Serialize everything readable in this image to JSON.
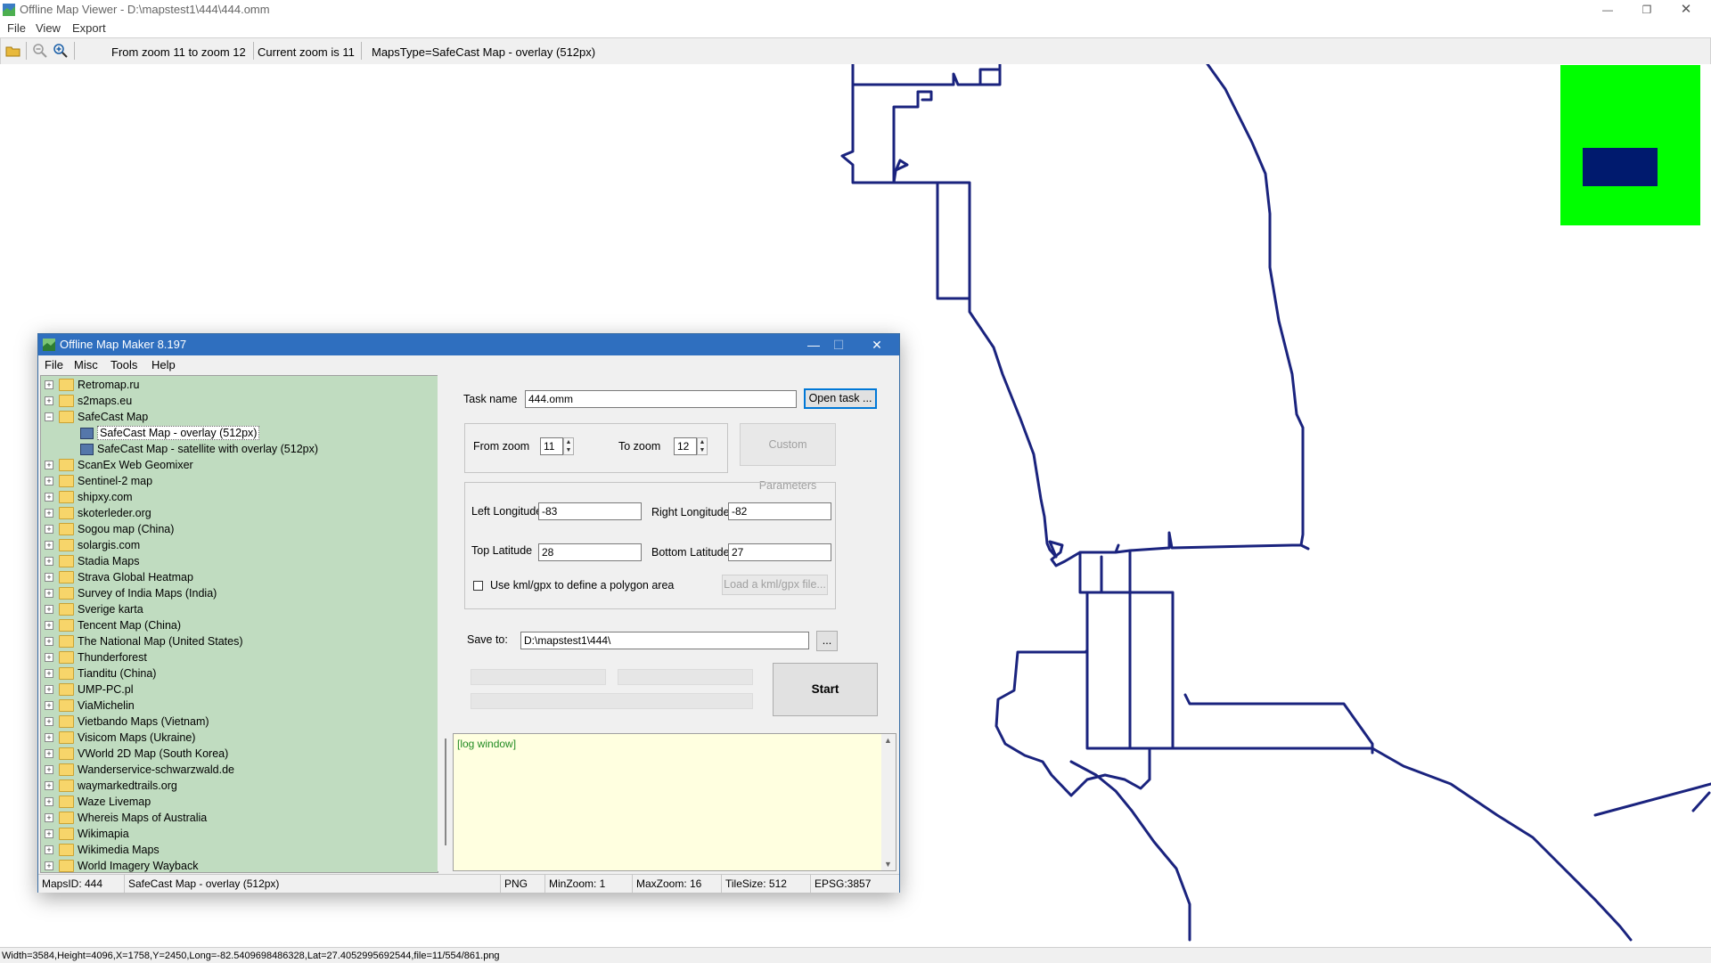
{
  "viewer": {
    "title": "Offline Map Viewer - D:\\mapstest1\\444\\444.omm",
    "menu": [
      "File",
      "View",
      "Export"
    ],
    "toolbar": {
      "zoom_range": "From zoom 11 to zoom 12",
      "current_zoom": "Current zoom is 11",
      "maps_type": "MapsType=SafeCast Map - overlay (512px)"
    },
    "status": "Width=3584,Height=4096,X=1758,Y=2450,Long=-82.5409698486328,Lat=27.4052995692544,file=11/554/861.png",
    "track_color": "#1a237e",
    "overview_bg": "#00ff00",
    "overview_rect": "#001a6e"
  },
  "dialog": {
    "title": "Offline Map Maker 8.197",
    "menu": [
      "File",
      "Misc",
      "Tools",
      "Help"
    ],
    "tree": [
      {
        "label": "Retromap.ru",
        "expanded": false
      },
      {
        "label": "s2maps.eu",
        "expanded": false
      },
      {
        "label": "SafeCast Map",
        "expanded": true
      },
      {
        "label": "SafeCast Map - overlay (512px)",
        "child": true,
        "selected": true
      },
      {
        "label": "SafeCast Map - satellite with overlay (512px)",
        "child": true
      },
      {
        "label": "ScanEx Web Geomixer",
        "expanded": false
      },
      {
        "label": "Sentinel-2 map",
        "expanded": false
      },
      {
        "label": "shipxy.com",
        "expanded": false
      },
      {
        "label": "skoterleder.org",
        "expanded": false
      },
      {
        "label": "Sogou map (China)",
        "expanded": false
      },
      {
        "label": "solargis.com",
        "expanded": false
      },
      {
        "label": "Stadia Maps",
        "expanded": false
      },
      {
        "label": "Strava Global Heatmap",
        "expanded": false
      },
      {
        "label": "Survey of India Maps (India)",
        "expanded": false
      },
      {
        "label": "Sverige karta",
        "expanded": false
      },
      {
        "label": "Tencent Map (China)",
        "expanded": false
      },
      {
        "label": "The National Map (United States)",
        "expanded": false
      },
      {
        "label": "Thunderforest",
        "expanded": false
      },
      {
        "label": "Tianditu (China)",
        "expanded": false
      },
      {
        "label": "UMP-PC.pl",
        "expanded": false
      },
      {
        "label": "ViaMichelin",
        "expanded": false
      },
      {
        "label": "Vietbando Maps (Vietnam)",
        "expanded": false
      },
      {
        "label": "Visicom Maps (Ukraine)",
        "expanded": false
      },
      {
        "label": "VWorld 2D Map (South Korea)",
        "expanded": false
      },
      {
        "label": "Wanderservice-schwarzwald.de",
        "expanded": false
      },
      {
        "label": "waymarkedtrails.org",
        "expanded": false
      },
      {
        "label": "Waze Livemap",
        "expanded": false
      },
      {
        "label": "Whereis Maps of Australia",
        "expanded": false
      },
      {
        "label": "Wikimapia",
        "expanded": false
      },
      {
        "label": "Wikimedia Maps",
        "expanded": false
      },
      {
        "label": "World Imagery Wayback",
        "expanded": false
      }
    ],
    "task_name_label": "Task name",
    "task_name_value": "444.omm",
    "open_task_label": "Open task ...",
    "from_zoom_label": "From zoom",
    "from_zoom_value": "11",
    "to_zoom_label": "To zoom",
    "to_zoom_value": "12",
    "custom_params_label": "Custom Parameters",
    "left_lon_label": "Left Longitude",
    "left_lon_value": "-83",
    "right_lon_label": "Right Longitude",
    "right_lon_value": "-82",
    "top_lat_label": "Top Latitude",
    "top_lat_value": "28",
    "bottom_lat_label": "Bottom Latitude",
    "bottom_lat_value": "27",
    "use_kml_label": "Use kml/gpx to define a polygon area",
    "load_kml_label": "Load a kml/gpx file...",
    "save_to_label": "Save to:",
    "save_to_value": "D:\\mapstest1\\444\\",
    "browse_label": "...",
    "start_label": "Start",
    "log_text": "[log window]",
    "status": {
      "maps_id": "MapsID: 444",
      "maps_name": "SafeCast Map - overlay (512px)",
      "format": "PNG",
      "min_zoom": "MinZoom: 1",
      "max_zoom": "MaxZoom: 16",
      "tile_size": "TileSize: 512",
      "epsg": "EPSG:3857"
    }
  }
}
